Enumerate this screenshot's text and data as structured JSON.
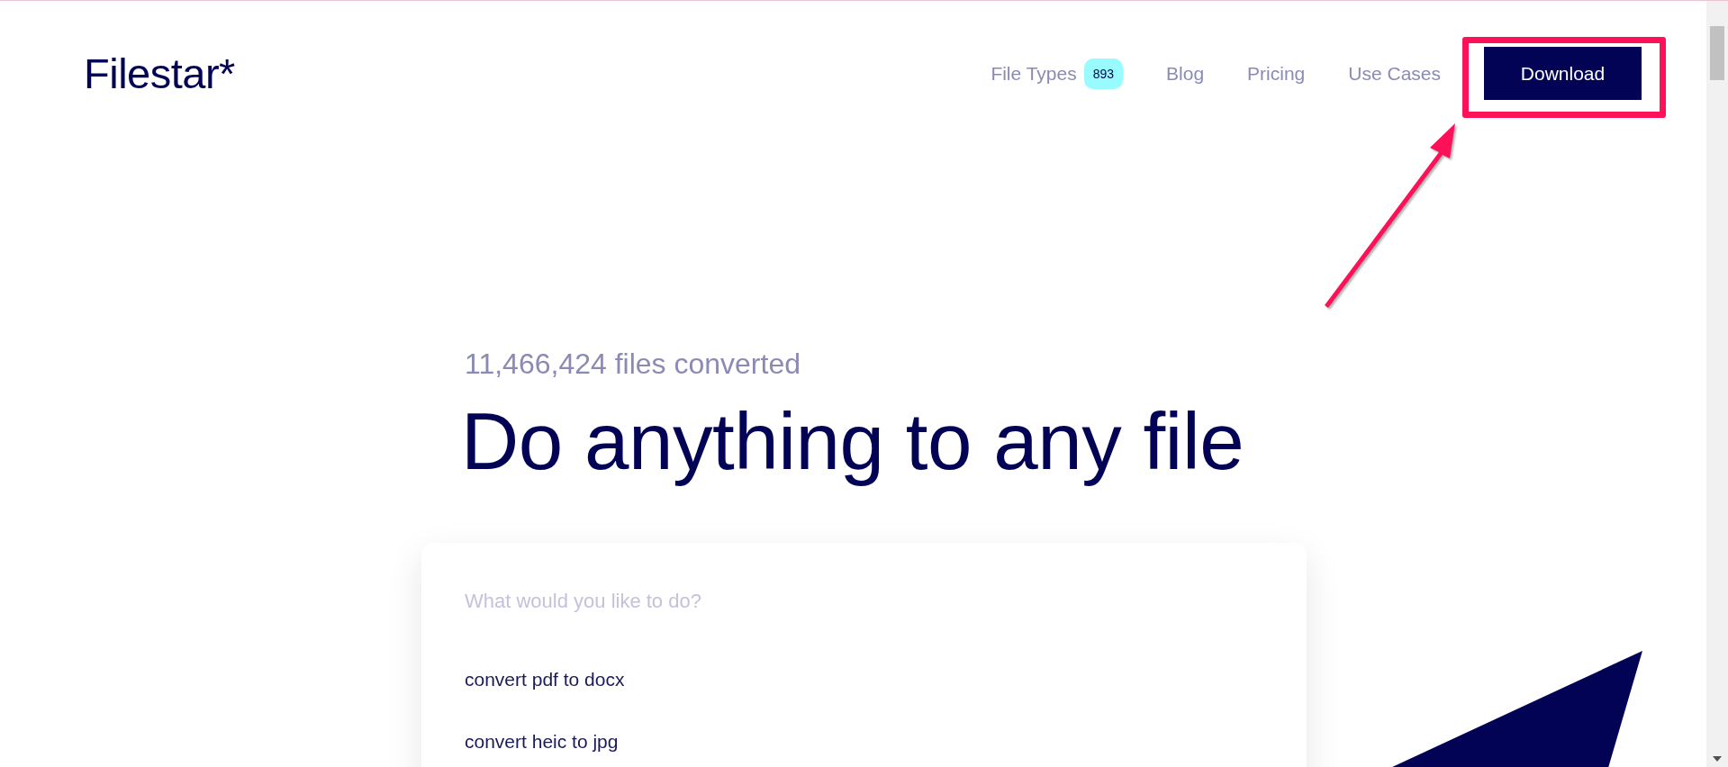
{
  "logo": "Filestar*",
  "nav": [
    {
      "label": "File Types",
      "badge": "893"
    },
    {
      "label": "Blog"
    },
    {
      "label": "Pricing"
    },
    {
      "label": "Use Cases"
    }
  ],
  "download_button": "Download",
  "stat": "11,466,424 files converted",
  "headline": "Do anything to any file",
  "search": {
    "placeholder": "What would you like to do?"
  },
  "suggestions": [
    "convert pdf to docx",
    "convert heic to jpg"
  ]
}
